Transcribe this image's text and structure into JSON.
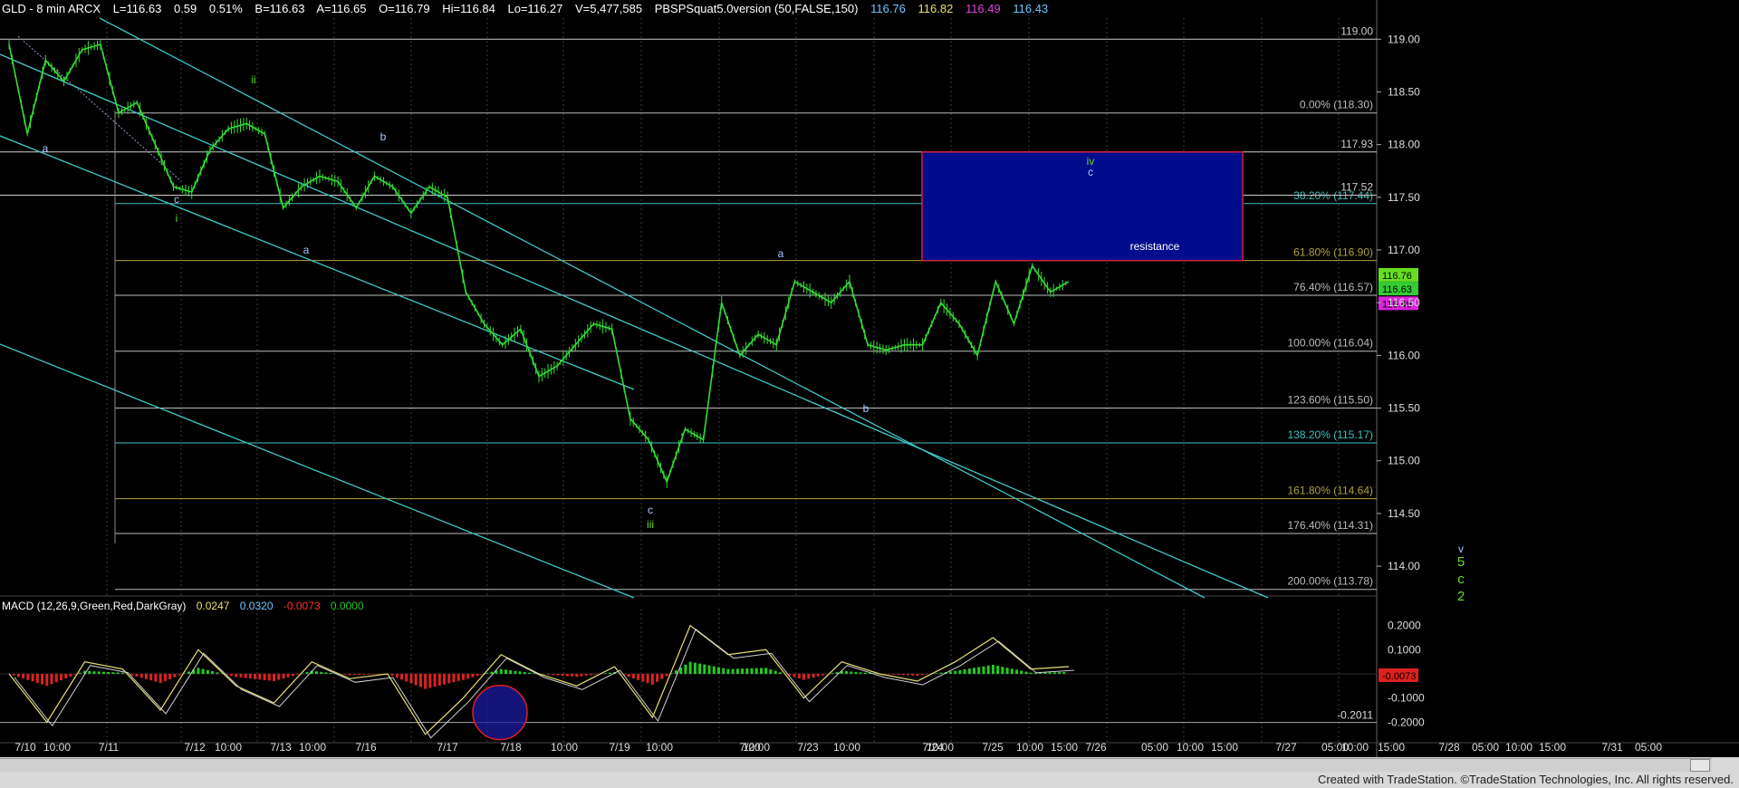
{
  "header": {
    "symbol": "GLD - 8 min  ARCX",
    "last": "L=116.63",
    "change": "0.59",
    "pct": "0.51%",
    "bid": "B=116.63",
    "ask": "A=116.65",
    "open": "O=116.79",
    "high": "Hi=116.84",
    "low": "Lo=116.27",
    "volume": "V=5,477,585",
    "study": "PBSPSquat5.0version (50,FALSE,150)",
    "study_values": [
      "116.76",
      "116.82",
      "116.49",
      "116.43"
    ]
  },
  "macd_header": {
    "label": "MACD (12,26,9,Green,Red,DarkGray)",
    "values": [
      "0.0247",
      "0.0320",
      "-0.0073",
      "0.0000"
    ]
  },
  "footer": "Created with TradeStation. ©TradeStation Technologies, Inc. All rights reserved.",
  "colors": {
    "bg": "#000000",
    "price": "#33dd33",
    "channel": "#40c8c8",
    "box_fill": "#000c8c",
    "box_border": "#d02040",
    "wave_green": "#66dd22",
    "wave_blue": "#a8c8ff",
    "fib_grey": "#bbbbbb",
    "fib_cyan": "#40c0c0",
    "fib_olive": "#b0a040"
  },
  "chart_data": {
    "type": "line",
    "instrument": "GLD",
    "interval": "8 min",
    "ylim": [
      113.7,
      119.2
    ],
    "yticks": [
      "119.00",
      "118.50",
      "118.00",
      "117.50",
      "117.00",
      "116.50",
      "116.00",
      "115.50",
      "115.00",
      "114.50",
      "114.00"
    ],
    "x_labels": [
      "7/10",
      "10:00",
      "7/11",
      "7/12",
      "10:00",
      "7/13",
      "10:00",
      "7/16",
      "7/17",
      "7/18",
      "10:00",
      "7/19",
      "10:00",
      "7/20",
      "10:00",
      "7/23",
      "10:00",
      "7/24",
      "10:00",
      "7/25",
      "10:00",
      "15:00",
      "7/26",
      "05:00",
      "10:00",
      "15:00",
      "7/27",
      "05:00",
      "10:00",
      "15:00",
      "7/28",
      "05:00",
      "10:00",
      "15:00",
      "7/31",
      "05:00"
    ],
    "series": [
      {
        "values": [
          118.95,
          118.1,
          118.8,
          118.6,
          118.9,
          118.95,
          118.3,
          118.4,
          118.0,
          117.6,
          117.55,
          117.95,
          118.15,
          118.2,
          118.1,
          117.4,
          117.6,
          117.7,
          117.65,
          117.4,
          117.7,
          117.6,
          117.35,
          117.6,
          117.5,
          116.6,
          116.3,
          116.1,
          116.25,
          115.8,
          115.9,
          116.1,
          116.3,
          116.25,
          115.4,
          115.2,
          114.8,
          115.3,
          115.2,
          116.5,
          116.0,
          116.2,
          116.1,
          116.7,
          116.6,
          116.5,
          116.7,
          116.1,
          116.05,
          116.1,
          116.1,
          116.5,
          116.3,
          116.0,
          116.7,
          116.3,
          116.85,
          116.6,
          116.7
        ]
      }
    ],
    "fib_levels": [
      {
        "label": "0.00% (118.30)",
        "value": 118.3
      },
      {
        "label": "38.20% (117.44)",
        "value": 117.44
      },
      {
        "label": "61.80% (116.90)",
        "value": 116.9
      },
      {
        "label": "76.40% (116.57)",
        "value": 116.57
      },
      {
        "label": "100.00% (116.04)",
        "value": 116.04
      },
      {
        "label": "123.60% (115.50)",
        "value": 115.5
      },
      {
        "label": "138.20% (115.17)",
        "value": 115.17
      },
      {
        "label": "161.80% (114.64)",
        "value": 114.64
      },
      {
        "label": "176.40% (114.31)",
        "value": 114.31
      },
      {
        "label": "200.00% (113.78)",
        "value": 113.78
      }
    ],
    "level_labels": [
      {
        "label": "119.00",
        "value": 119.0
      },
      {
        "label": "117.93",
        "value": 117.93
      },
      {
        "label": "117.52",
        "value": 117.52
      }
    ],
    "price_tags": [
      {
        "label": "116.76",
        "value": 116.76,
        "color": "#66dd22"
      },
      {
        "label": "116.63",
        "value": 116.63,
        "color": "#33cc33"
      },
      {
        "label": "116.49",
        "value": 116.49,
        "color": "#dd22dd"
      }
    ],
    "resistance_box": {
      "label": "resistance",
      "from": 116.9,
      "to": 117.93
    },
    "wave_labels": [
      "a",
      "c",
      "i",
      "ii",
      "b",
      "a",
      "c",
      "iii",
      "a",
      "b",
      "iv",
      "c",
      "v",
      "5",
      "c",
      "2"
    ],
    "macd": {
      "ylim": [
        -0.27,
        0.27
      ],
      "yticks": [
        "0.2000",
        "0.1000",
        "-0.1000",
        "-0.2000"
      ],
      "tags": [
        "-0.0073",
        "-0.2011"
      ],
      "macd_line": [
        0.0,
        -0.2,
        0.05,
        0.02,
        -0.15,
        0.1,
        -0.05,
        -0.12,
        0.05,
        -0.02,
        0.0,
        -0.25,
        -0.1,
        0.08,
        0.0,
        -0.05,
        0.03,
        -0.18,
        0.2,
        0.08,
        0.1,
        -0.1,
        0.05,
        0.0,
        -0.03,
        0.05,
        0.15,
        0.02,
        0.03
      ]
    }
  }
}
